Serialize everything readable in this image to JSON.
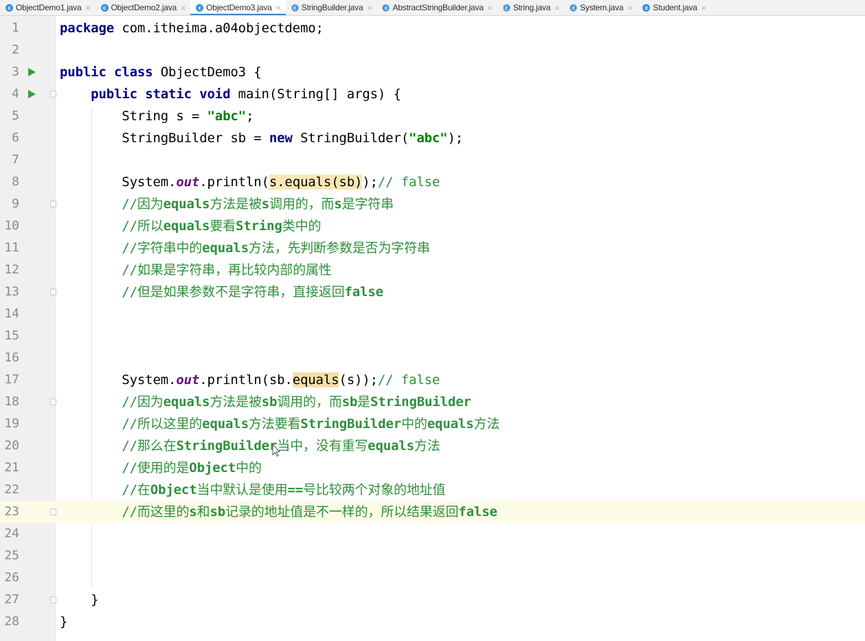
{
  "tabs": [
    {
      "label": "ObjectDemo1.java",
      "active": false,
      "icon": "class-icon"
    },
    {
      "label": "ObjectDemo2.java",
      "active": false,
      "icon": "class-icon"
    },
    {
      "label": "ObjectDemo3.java",
      "active": true,
      "icon": "class-icon"
    },
    {
      "label": "StringBuilder.java",
      "active": false,
      "icon": "library-class-icon"
    },
    {
      "label": "AbstractStringBuilder.java",
      "active": false,
      "icon": "library-class-icon"
    },
    {
      "label": "String.java",
      "active": false,
      "icon": "library-class-icon"
    },
    {
      "label": "System.java",
      "active": false,
      "icon": "library-class-icon"
    },
    {
      "label": "Student.java",
      "active": false,
      "icon": "class-icon"
    }
  ],
  "colors": {
    "keyword": "#000080",
    "string": "#008000",
    "comment": "#2f8f3b",
    "static_field": "#660e7a",
    "highlight": "#fbe7b5",
    "current_line": "#fdfbe6",
    "active_tab_underline": "#4083c9"
  },
  "code": {
    "current_line": 23,
    "lines": [
      {
        "n": "1",
        "segments": [
          {
            "t": "package",
            "c": "kw"
          },
          {
            "t": " com.itheima.a04objectdemo;"
          }
        ]
      },
      {
        "n": "2",
        "segments": []
      },
      {
        "n": "3",
        "run": true,
        "segments": [
          {
            "t": "public",
            "c": "kw"
          },
          {
            "t": " "
          },
          {
            "t": "class",
            "c": "kw"
          },
          {
            "t": " ObjectDemo3 {"
          }
        ]
      },
      {
        "n": "4",
        "run": true,
        "fold": true,
        "segments": [
          {
            "t": "    "
          },
          {
            "t": "public",
            "c": "kw"
          },
          {
            "t": " "
          },
          {
            "t": "static",
            "c": "kw"
          },
          {
            "t": " "
          },
          {
            "t": "void",
            "c": "kw"
          },
          {
            "t": " main(String[] args) {"
          }
        ]
      },
      {
        "n": "5",
        "segments": [
          {
            "t": "        String s = "
          },
          {
            "t": "\"abc\"",
            "c": "str"
          },
          {
            "t": ";"
          }
        ]
      },
      {
        "n": "6",
        "segments": [
          {
            "t": "        StringBuilder sb = "
          },
          {
            "t": "new",
            "c": "kw"
          },
          {
            "t": " StringBuilder("
          },
          {
            "t": "\"abc\"",
            "c": "str"
          },
          {
            "t": ");"
          }
        ]
      },
      {
        "n": "7",
        "segments": []
      },
      {
        "n": "8",
        "segments": [
          {
            "t": "        System."
          },
          {
            "t": "out",
            "c": "field"
          },
          {
            "t": ".println("
          },
          {
            "t": "s.equals(sb)",
            "c": "hl"
          },
          {
            "t": ");"
          },
          {
            "t": "// false",
            "c": "cmt"
          }
        ]
      },
      {
        "n": "9",
        "fold": true,
        "segments": [
          {
            "t": "        "
          },
          {
            "t": "//因为equals方法是被s调用的，而s是字符串",
            "c": "cmt"
          }
        ]
      },
      {
        "n": "10",
        "segments": [
          {
            "t": "        "
          },
          {
            "t": "//所以equals要看String类中的",
            "c": "cmt"
          }
        ]
      },
      {
        "n": "11",
        "segments": [
          {
            "t": "        "
          },
          {
            "t": "//字符串中的equals方法，先判断参数是否为字符串",
            "c": "cmt"
          }
        ]
      },
      {
        "n": "12",
        "segments": [
          {
            "t": "        "
          },
          {
            "t": "//如果是字符串，再比较内部的属性",
            "c": "cmt"
          }
        ]
      },
      {
        "n": "13",
        "fold": true,
        "segments": [
          {
            "t": "        "
          },
          {
            "t": "//但是如果参数不是字符串，直接返回false",
            "c": "cmt"
          }
        ]
      },
      {
        "n": "14",
        "segments": []
      },
      {
        "n": "15",
        "segments": []
      },
      {
        "n": "16",
        "segments": []
      },
      {
        "n": "17",
        "segments": [
          {
            "t": "        System."
          },
          {
            "t": "out",
            "c": "field"
          },
          {
            "t": ".println(sb."
          },
          {
            "t": "equals",
            "c": "hl2"
          },
          {
            "t": "(s));"
          },
          {
            "t": "// false",
            "c": "cmt"
          }
        ]
      },
      {
        "n": "18",
        "fold": true,
        "segments": [
          {
            "t": "        "
          },
          {
            "t": "//因为equals方法是被sb调用的，而sb是StringBuilder",
            "c": "cmt"
          }
        ]
      },
      {
        "n": "19",
        "segments": [
          {
            "t": "        "
          },
          {
            "t": "//所以这里的equals方法要看StringBuilder中的equals方法",
            "c": "cmt"
          }
        ]
      },
      {
        "n": "20",
        "segments": [
          {
            "t": "        "
          },
          {
            "t": "//那么在StringBuilder当中，没有重写equals方法",
            "c": "cmt"
          }
        ]
      },
      {
        "n": "21",
        "segments": [
          {
            "t": "        "
          },
          {
            "t": "//使用的是Object中的",
            "c": "cmt"
          }
        ]
      },
      {
        "n": "22",
        "segments": [
          {
            "t": "        "
          },
          {
            "t": "//在Object当中默认是使用==号比较两个对象的地址值",
            "c": "cmt"
          }
        ]
      },
      {
        "n": "23",
        "fold": true,
        "segments": [
          {
            "t": "        "
          },
          {
            "t": "//而这里的s和sb记录的地址值是不一样的，所以结果返回false",
            "c": "cmt"
          }
        ]
      },
      {
        "n": "24",
        "segments": []
      },
      {
        "n": "25",
        "segments": []
      },
      {
        "n": "26",
        "segments": []
      },
      {
        "n": "27",
        "fold": true,
        "segments": [
          {
            "t": "    }"
          }
        ]
      },
      {
        "n": "28",
        "segments": [
          {
            "t": "}"
          }
        ]
      }
    ]
  }
}
